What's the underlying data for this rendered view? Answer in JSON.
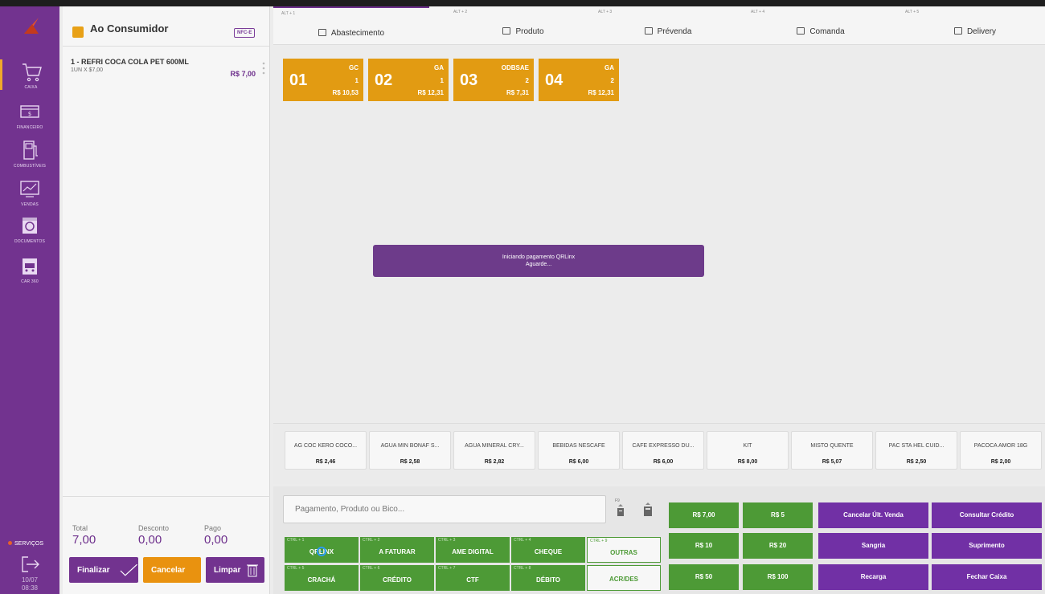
{
  "sidebar": {
    "items": [
      {
        "label": "CAIXA",
        "icon": "cart-icon"
      },
      {
        "label": "FINANCEIRO",
        "icon": "money-icon"
      },
      {
        "label": "COMBUSTÍVEIS",
        "icon": "fuel-pump-icon"
      },
      {
        "label": "VENDAS",
        "icon": "chart-icon"
      },
      {
        "label": "DOCUMENTOS",
        "icon": "document-icon"
      },
      {
        "label": "CAR 360",
        "icon": "car-icon"
      }
    ],
    "services_label": "SERVIÇOS",
    "date": "10/07",
    "time": "08:38"
  },
  "cart": {
    "customer": "Ao Consumidor",
    "nfce_label": "NFC-E",
    "items": [
      {
        "name": "1 - REFRI COCA COLA PET 600ML",
        "detail": "1UN X $7,00",
        "price": "R$ 7,00"
      }
    ],
    "totals": {
      "total_label": "Total",
      "total_value": "7,00",
      "discount_label": "Desconto",
      "discount_value": "0,00",
      "paid_label": "Pago",
      "paid_value": "0,00"
    },
    "buttons": {
      "finalize": "Finalizar",
      "cancel": "Cancelar",
      "clear": "Limpar"
    }
  },
  "tabs": [
    {
      "shortcut": "ALT + 1",
      "label": "Abastecimento",
      "icon": "fuel-icon"
    },
    {
      "shortcut": "ALT + 2",
      "label": "Produto",
      "icon": "basket-icon"
    },
    {
      "shortcut": "ALT + 3",
      "label": "Prévenda",
      "icon": "ticket-icon"
    },
    {
      "shortcut": "ALT + 4",
      "label": "Comanda",
      "icon": "person-icon"
    },
    {
      "shortcut": "ALT + 5",
      "label": "Delivery",
      "icon": "delivery-icon"
    }
  ],
  "pumps": [
    {
      "number": "01",
      "fuel": "GC",
      "qty": "1",
      "amount": "R$ 10,53"
    },
    {
      "number": "02",
      "fuel": "GA",
      "qty": "1",
      "amount": "R$ 12,31"
    },
    {
      "number": "03",
      "fuel": "ODBSAE",
      "qty": "2",
      "amount": "R$ 7,31"
    },
    {
      "number": "04",
      "fuel": "GA",
      "qty": "2",
      "amount": "R$ 12,31"
    }
  ],
  "toast": {
    "line1": "Iniciando pagamento QRLinx",
    "line2": "Aguarde..."
  },
  "products": [
    {
      "name": "AG COC KERO COCO...",
      "price": "R$ 2,46"
    },
    {
      "name": "AGUA MIN BONAF S...",
      "price": "R$ 2,58"
    },
    {
      "name": "AGUA MINERAL CRY...",
      "price": "R$ 2,82"
    },
    {
      "name": "BEBIDAS NESCAFE",
      "price": "R$ 6,00"
    },
    {
      "name": "CAFE EXPRESSO DU...",
      "price": "R$ 6,00"
    },
    {
      "name": "KIT",
      "price": "R$ 8,00"
    },
    {
      "name": "MISTO QUENTE",
      "price": "R$ 5,07"
    },
    {
      "name": "PAC STA HEL CUID...",
      "price": "R$ 2,50"
    },
    {
      "name": "PACOCA AMOR 18G",
      "price": "R$ 2,00"
    }
  ],
  "search": {
    "placeholder": "Pagamento, Produto ou Bico...",
    "f9_label": "F9"
  },
  "payments": [
    {
      "shortcut": "CTRL + 1",
      "label": "QRLINX"
    },
    {
      "shortcut": "CTRL + 2",
      "label": "A FATURAR"
    },
    {
      "shortcut": "CTRL + 3",
      "label": "AME DIGITAL"
    },
    {
      "shortcut": "CTRL + 4",
      "label": "CHEQUE"
    },
    {
      "shortcut": "CTRL + 9",
      "label": "OUTRAS"
    },
    {
      "shortcut": "CTRL + 5",
      "label": "CRACHÁ"
    },
    {
      "shortcut": "CTRL + 6",
      "label": "CRÉDITO"
    },
    {
      "shortcut": "CTRL + 7",
      "label": "CTF"
    },
    {
      "shortcut": "CTRL + 8",
      "label": "DÉBITO"
    },
    {
      "shortcut": "",
      "label": "ACR/DES"
    }
  ],
  "quick_amounts": [
    "R$ 7,00",
    "R$ 5",
    "R$ 10",
    "R$ 20",
    "R$ 50",
    "R$ 100"
  ],
  "actions": [
    "Cancelar Últ. Venda",
    "Consultar Crédito",
    "Sangria",
    "Suprimento",
    "Recarga",
    "Fechar Caixa"
  ],
  "colors": {
    "purple": "#72338f",
    "orange": "#e29b12",
    "green": "#4d9a36"
  }
}
